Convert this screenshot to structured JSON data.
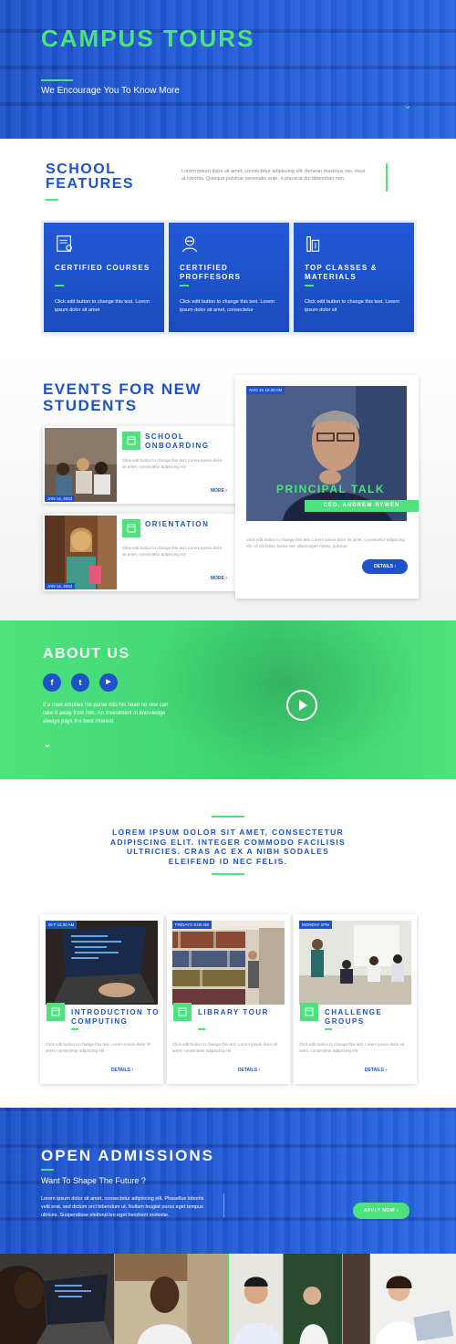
{
  "hero": {
    "title": "CAMPUS TOURS",
    "subtitle": "We Encourage You To Know More"
  },
  "features": {
    "title": "SCHOOL FEATURES",
    "description": "Lorem ipsum dolor sit amet, consectetur adipiscing elit. Aenean maximus nec risus at lobortis. Quisque pulvinar venenatis ante, a placerat dui bibendum non.",
    "cards": [
      {
        "icon": "certificate-icon",
        "title": "CERTIFIED COURSES",
        "text": "Click edit button to change this text. Lorem ipsum dolor sit amet"
      },
      {
        "icon": "professor-icon",
        "title": "CERTIFIED PROFFESORS",
        "text": "Click edit button to change this text. Lorem ipsum dolor sit amet, consectetur"
      },
      {
        "icon": "materials-icon",
        "title": "TOP CLASSES & MATERIALS",
        "text": "Click edit button to change this text. Lorem ipsum dolor sit"
      }
    ]
  },
  "events": {
    "title": "EVENTS FOR NEW STUDENTS",
    "items": [
      {
        "title": "SCHOOL ONBOARDING",
        "date": "JAN 14, 2022",
        "text": "Click edit button to change this text. Lorem ipsum dolor sit amet, consectetur adipiscing elit",
        "more": "MORE ›"
      },
      {
        "title": "ORIENTATION",
        "date": "JAN 14, 2022",
        "text": "Click edit button to change this text. Lorem ipsum dolor sit amet, consectetur adipiscing elit",
        "more": "MORE ›"
      }
    ],
    "featured": {
      "date": "AUG 15 10:30 AM",
      "title": "PRINCIPAL TALK",
      "role": "CEO. ANDREW RYWEN",
      "text": "Click edit button to change this text. Lorem ipsum dolor sit amet, consectetur adipiscing elit. Ut elit tellus, luctus nec ullamcorper mattis, pulvinar",
      "button": "DETAILS ›"
    }
  },
  "about": {
    "title": "ABOUT US",
    "social": [
      "f",
      "t",
      "▶"
    ],
    "quote": "If a man empties his purse into his head no one can take it away from him. An investment in knowledge always pays the best interest."
  },
  "quote": {
    "text": "LOREM IPSUM DOLOR SIT AMET, CONSECTETUR ADIPISCING ELIT. INTEGER COMMODO FACILISIS ULTRICIES. CRAS AC EX A NIBH SODALES ELEIFEND ID NEC FELIS."
  },
  "courses": [
    {
      "date": "W-F 11:30 AM",
      "title": "INTRODUCTION TO COMPUTING",
      "text": "Click edit button to change this text. Lorem ipsum dolor sit amet, consectetur adipiscing elit",
      "more": "DETAILS ›"
    },
    {
      "date": "FRIDAYS 8:00 AM",
      "title": "LIBRARY TOUR",
      "text": "Click edit button to change this text. Lorem ipsum dolor sit amet, consectetur adipiscing elit",
      "more": "DETAILS ›"
    },
    {
      "date": "MONDAY 1PM",
      "title": "CHALLENGE GROUPS",
      "text": "Click edit button to change this text. Lorem ipsum dolor sit amet, consectetur adipiscing elit",
      "more": "DETAILS ›"
    }
  ],
  "admissions": {
    "title": "OPEN ADMISSIONS",
    "subtitle": "Want To Shape The Future ?",
    "text": "Lorem ipsum dolor sit amet, consectetur adipiscing elit. Phasellus lobortis velit erat, sed dictum orci bibendum ut. Nullam feugiat purus eget tempus ultrices. Suspendisse eleifend leo eget hendrerit molestie.",
    "button": "APPLY NOW ›"
  },
  "colors": {
    "primary": "#1d52c9",
    "accent": "#4ee27d"
  }
}
